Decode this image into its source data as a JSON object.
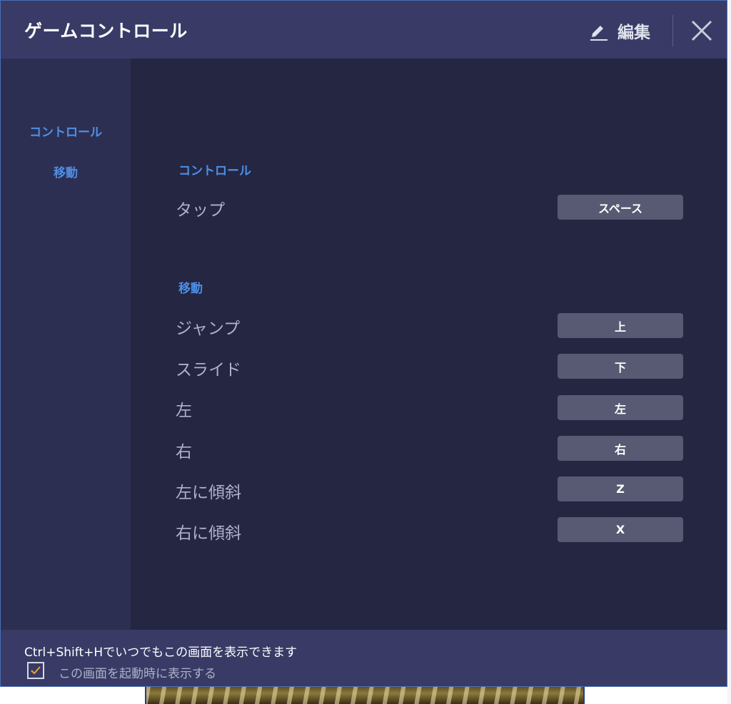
{
  "dialog": {
    "title": "ゲームコントロール",
    "edit_label": "編集"
  },
  "sidebar": {
    "items": [
      {
        "label": "コントロール"
      },
      {
        "label": "移動"
      }
    ]
  },
  "sections": {
    "control": {
      "title": "コントロール",
      "rows": [
        {
          "label": "タップ",
          "key": "スペース"
        }
      ]
    },
    "movement": {
      "title": "移動",
      "rows": [
        {
          "label": "ジャンプ",
          "key": "上"
        },
        {
          "label": "スライド",
          "key": "下"
        },
        {
          "label": "左",
          "key": "左"
        },
        {
          "label": "右",
          "key": "右"
        },
        {
          "label": "左に傾斜",
          "key": "Z"
        },
        {
          "label": "右に傾斜",
          "key": "X"
        }
      ]
    }
  },
  "footer": {
    "hint": "Ctrl+Shift+Hでいつでもこの画面を表示できます",
    "checkbox_label": "この画面を起動時に表示する",
    "checkbox_checked": true
  },
  "colors": {
    "accent": "#4d8fe6",
    "checkmark": "#f0a030",
    "titlebar": "#393b66",
    "content_bg": "#242642",
    "sidebar_bg": "#2d2f52",
    "key_bg": "#575a72"
  },
  "icons": {
    "edit": "pencil-icon",
    "close": "close-icon",
    "check": "checkmark-icon"
  }
}
